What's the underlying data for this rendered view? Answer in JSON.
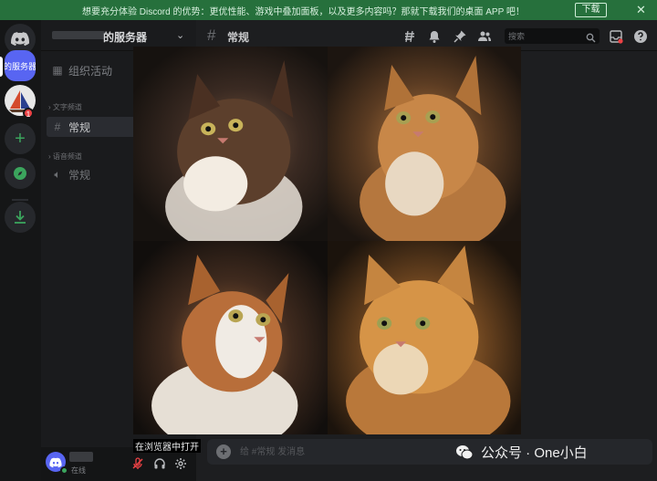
{
  "banner": {
    "text": "想要充分体验 Discord 的优势：更优性能、游戏中叠加面板，以及更多内容吗？那就下载我们的桌面 APP 吧！",
    "download_label": "下载",
    "close_icon": "close-icon"
  },
  "rail": {
    "server_label": "的服务器",
    "badge_count": "1"
  },
  "sidebar": {
    "server_name": "的服务器",
    "events_label": "组织活动",
    "text_category": "文字频道",
    "text_channel": "常规",
    "voice_category": "语音频道",
    "voice_channel": "常规"
  },
  "user": {
    "status": "在线"
  },
  "topbar": {
    "channel_name": "常规",
    "search_placeholder": "搜索"
  },
  "overlay": {
    "open_in_browser": "在浏览器中打开"
  },
  "composer": {
    "placeholder": "给 #常规 发消息"
  },
  "watermark": {
    "text": "公众号 · One小白"
  },
  "colors": {
    "banner": "#26703c",
    "blurple": "#5865f2",
    "online": "#3ba55d",
    "badge": "#ed4245"
  }
}
